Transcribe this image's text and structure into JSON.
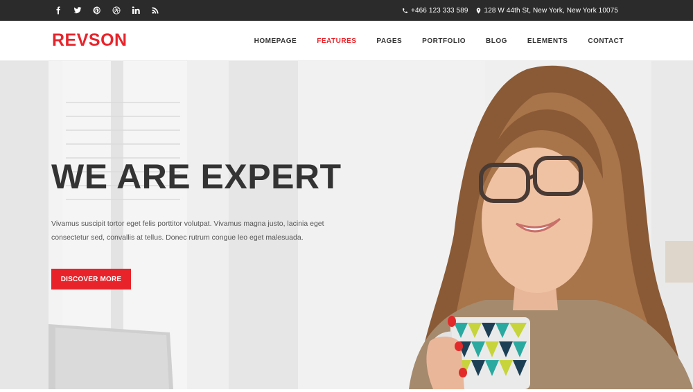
{
  "topbar": {
    "social_icons": [
      "facebook-icon",
      "twitter-icon",
      "pinterest-icon",
      "dribbble-icon",
      "linkedin-icon",
      "rss-icon"
    ],
    "phone": "+466 123 333 589",
    "address": "128 W 44th St, New York, New York 10075"
  },
  "header": {
    "logo": "REVSON",
    "nav": [
      {
        "label": "HOMEPAGE",
        "active": false
      },
      {
        "label": "FEATURES",
        "active": true
      },
      {
        "label": "PAGES",
        "active": false
      },
      {
        "label": "PORTFOLIO",
        "active": false
      },
      {
        "label": "BLOG",
        "active": false
      },
      {
        "label": "ELEMENTS",
        "active": false
      },
      {
        "label": "CONTACT",
        "active": false
      }
    ]
  },
  "hero": {
    "title": "WE ARE EXPERT",
    "text": "Vivamus suscipit tortor eget felis porttitor volutpat. Vivamus magna justo, lacinia eget consectetur sed, convallis at tellus. Donec rutrum congue leo eget malesuada.",
    "button": "DISCOVER MORE",
    "image": "woman-with-glasses-holding-mug-photo"
  },
  "colors": {
    "accent": "#e8232a",
    "topbar": "#2b2b2b",
    "text_dark": "#333333"
  }
}
